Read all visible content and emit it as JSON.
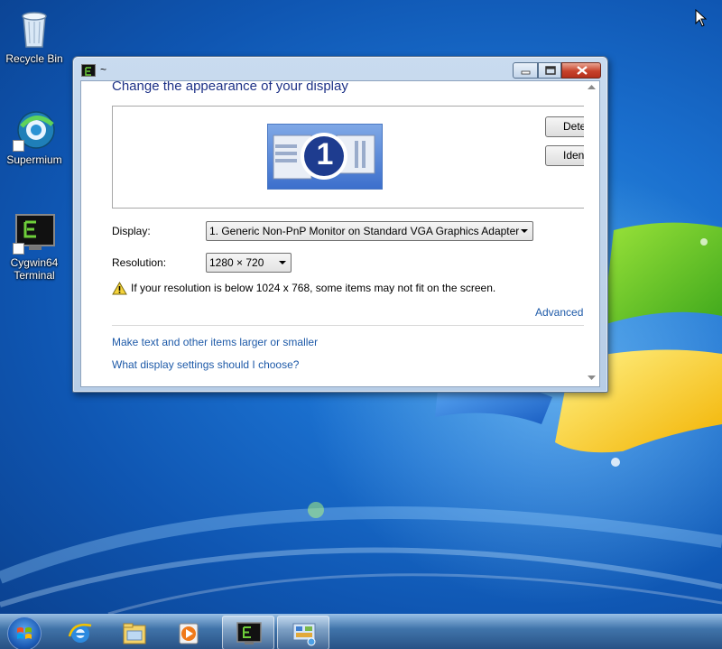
{
  "desktop": {
    "icons": [
      {
        "label": "Recycle Bin"
      },
      {
        "label": "Supermium"
      },
      {
        "label": "Cygwin64\nTerminal"
      }
    ]
  },
  "window": {
    "title": "~",
    "content": {
      "heading": "Change the appearance of your display",
      "monitor_number": "1",
      "detect_button": "Detect",
      "identify_button": "Identify",
      "display_label": "Display:",
      "display_value": "1. Generic Non-PnP Monitor on Standard VGA Graphics Adapter",
      "resolution_label": "Resolution:",
      "resolution_value": "1280 × 720",
      "warning_text": "If your resolution is below 1024 x 768, some items may not fit on the screen.",
      "advanced_link": "Advanced settings",
      "links": [
        "Make text and other items larger or smaller",
        "What display settings should I choose?"
      ]
    }
  },
  "taskbar": {
    "items": [
      {
        "name": "internet-explorer-icon",
        "active": false
      },
      {
        "name": "file-explorer-icon",
        "active": false
      },
      {
        "name": "media-player-icon",
        "active": false
      },
      {
        "name": "cygwin-terminal-icon",
        "active": true
      },
      {
        "name": "control-panel-icon",
        "active": true
      }
    ]
  },
  "colors": {
    "link": "#1e5aa8",
    "heading": "#1e3287",
    "desktop": "#1a6fce"
  }
}
